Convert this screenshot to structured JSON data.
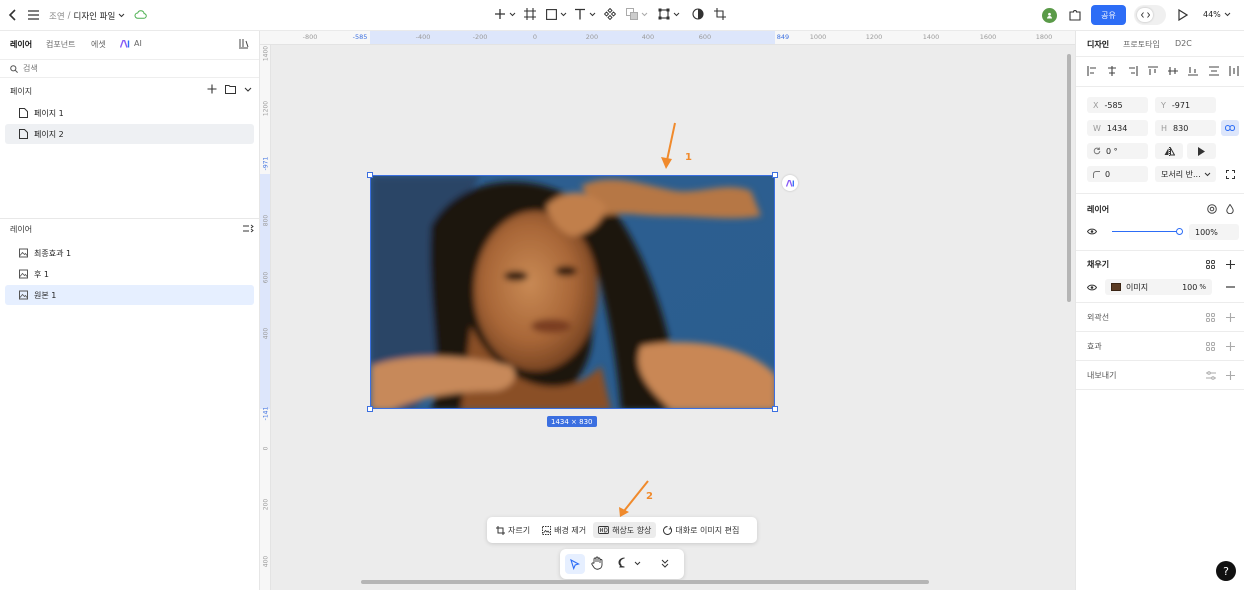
{
  "header": {
    "breadcrumb_parent": "조연",
    "breadcrumb_sep": "/",
    "file_name": "디자인 파일",
    "share_label": "공유",
    "zoom": "44%"
  },
  "left": {
    "tabs": [
      {
        "label": "레이어"
      },
      {
        "label": "컴포넌트"
      },
      {
        "label": "에셋"
      },
      {
        "label": "AI"
      }
    ],
    "search_placeholder": "검색",
    "pages_title": "페이지",
    "pages": [
      {
        "label": "페이지 1"
      },
      {
        "label": "페이지 2"
      }
    ],
    "layers_title": "레이어",
    "layers": [
      {
        "label": "최종효과 1"
      },
      {
        "label": "후 1"
      },
      {
        "label": "원본 1"
      }
    ]
  },
  "canvas": {
    "ruler_h": [
      "-800",
      "-585",
      "-400",
      "-200",
      "0",
      "200",
      "400",
      "600",
      "849",
      "1000",
      "1200",
      "1400",
      "1600",
      "1800"
    ],
    "ruler_v": [
      "1400",
      "1200",
      "-971",
      "800",
      "600",
      "400",
      "-141",
      "0",
      "200",
      "400",
      "600"
    ],
    "size_badge": "1434 × 830",
    "annotation_1": "1",
    "annotation_2": "2",
    "actions": [
      {
        "label": "자르기"
      },
      {
        "label": "배경 제거"
      },
      {
        "label": "해상도 향상"
      },
      {
        "label": "대화로 이미지 편집"
      }
    ]
  },
  "right": {
    "tabs": [
      {
        "label": "디자인"
      },
      {
        "label": "프로토타입"
      },
      {
        "label": "D2C"
      }
    ],
    "x_key": "X",
    "x": "-585",
    "y_key": "Y",
    "y": "-971",
    "w_key": "W",
    "w": "1434",
    "h_key": "H",
    "h": "830",
    "rotation": "0 °",
    "radius": "0",
    "corner_mode": "모서리 반...",
    "layer_title": "레이어",
    "opacity": "100%",
    "fill_title": "채우기",
    "fill_label": "이미지",
    "fill_opacity": "100",
    "fill_opacity_unit": "%",
    "stroke_title": "외곽선",
    "effects_title": "효과",
    "export_title": "내보내기",
    "help": "?"
  },
  "colors": {
    "accent": "#2d6df6",
    "selection": "#3b6fe0",
    "annotation": "#f08a2c"
  }
}
